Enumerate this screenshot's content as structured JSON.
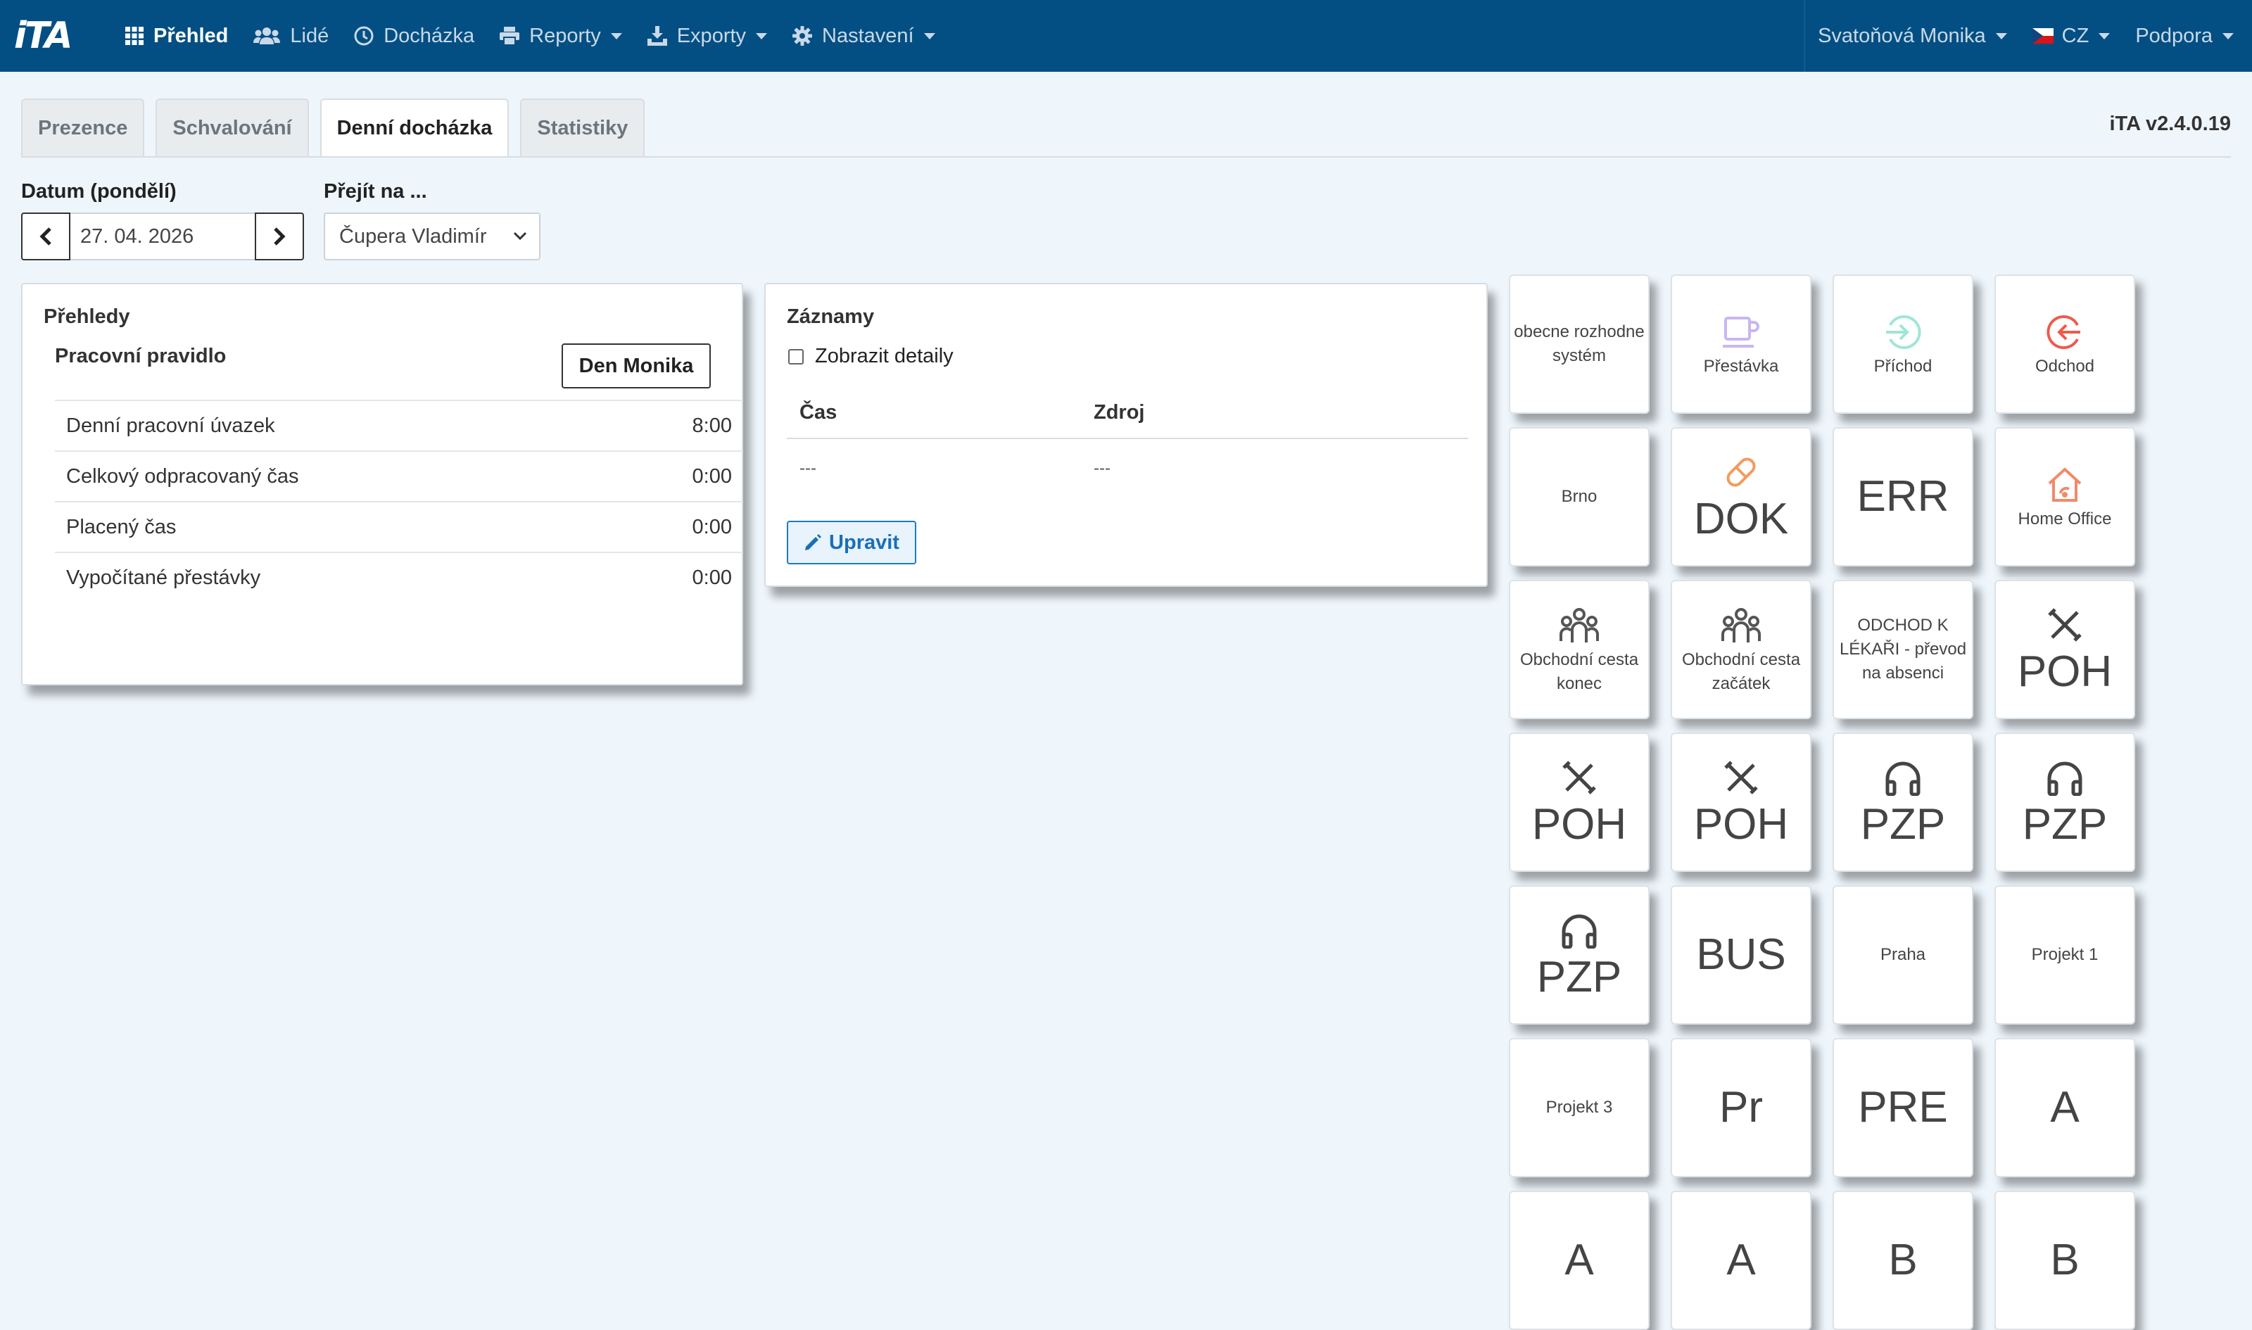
{
  "navbar": {
    "logo": "iTA",
    "items": [
      {
        "label": "Přehled",
        "icon": "grid-icon",
        "active": true
      },
      {
        "label": "Lidé",
        "icon": "users-icon"
      },
      {
        "label": "Docházka",
        "icon": "clock-icon"
      },
      {
        "label": "Reporty",
        "icon": "print-icon"
      },
      {
        "label": "Exporty",
        "icon": "export-icon"
      },
      {
        "label": "Nastavení",
        "icon": "gear-icon"
      }
    ],
    "user": "Svatoňová Monika",
    "language": "CZ",
    "support": "Podpora"
  },
  "tabs": [
    "Prezence",
    "Schvalování",
    "Denní docházka",
    "Statistiky"
  ],
  "active_tab": "Denní docházka",
  "version": "iTA v2.4.0.19",
  "date": {
    "label": "Datum (pondělí)",
    "value": "27. 04. 2026"
  },
  "goto": {
    "label": "Přejít na ...",
    "value": "Čupera Vladimír"
  },
  "overview": {
    "title": "Přehledy",
    "rule_label": "Pracovní pravidlo",
    "rule_button": "Den Monika",
    "rows": [
      {
        "label": "Denní pracovní úvazek",
        "value": "8:00"
      },
      {
        "label": "Celkový odpracovaný čas",
        "value": "0:00"
      },
      {
        "label": "Placený čas",
        "value": "0:00"
      },
      {
        "label": "Vypočítané přestávky",
        "value": "0:00"
      }
    ]
  },
  "records": {
    "title": "Záznamy",
    "show_details": "Zobrazit detaily",
    "columns": [
      "Čas",
      "Zdroj"
    ],
    "rows": [
      [
        "---",
        "---"
      ]
    ],
    "edit_button": "Upravit"
  },
  "terminal": [
    {
      "text": "obecne rozhodne systém",
      "style": "small"
    },
    {
      "text": "Přestávka",
      "style": "small",
      "icon": "coffee-icon",
      "color": "#c9b6f0"
    },
    {
      "text": "Příchod",
      "style": "small",
      "icon": "sign-in-icon",
      "color": "#9ee6d6"
    },
    {
      "text": "Odchod",
      "style": "small",
      "icon": "sign-out-icon",
      "color": "#ee5a4b"
    },
    {
      "text": "Brno",
      "style": "small"
    },
    {
      "text": "DOK",
      "style": "big",
      "icon": "pill-icon",
      "color": "#f39b5e"
    },
    {
      "text": "ERR",
      "style": "big"
    },
    {
      "text": "Home Office",
      "style": "small",
      "icon": "home-icon",
      "color": "#f08a6a"
    },
    {
      "text": "Obchodní cesta konec",
      "style": "small",
      "icon": "people-icon",
      "color": "#555555"
    },
    {
      "text": "Obchodní cesta začátek",
      "style": "small",
      "icon": "people-icon",
      "color": "#555555"
    },
    {
      "text": "ODCHOD K LÉKAŘI - převod na absenci",
      "style": "small"
    },
    {
      "text": "POH",
      "style": "big",
      "icon": "tools-icon",
      "color": "#444444"
    },
    {
      "text": "POH",
      "style": "big",
      "icon": "tools-icon",
      "color": "#444444"
    },
    {
      "text": "POH",
      "style": "big",
      "icon": "tools-icon",
      "color": "#444444"
    },
    {
      "text": "PZP",
      "style": "big",
      "icon": "headphones-icon",
      "color": "#444444"
    },
    {
      "text": "PZP",
      "style": "big",
      "icon": "headphones-icon",
      "color": "#444444"
    },
    {
      "text": "PZP",
      "style": "big",
      "icon": "headphones-icon",
      "color": "#444444"
    },
    {
      "text": "BUS",
      "style": "big"
    },
    {
      "text": "Praha",
      "style": "small"
    },
    {
      "text": "Projekt 1",
      "style": "small"
    },
    {
      "text": "Projekt 3",
      "style": "small"
    },
    {
      "text": "Pr",
      "style": "big"
    },
    {
      "text": "PRE",
      "style": "big"
    },
    {
      "text": "A",
      "style": "big"
    },
    {
      "text": "A",
      "style": "big"
    },
    {
      "text": "A",
      "style": "big"
    },
    {
      "text": "B",
      "style": "big"
    },
    {
      "text": "B",
      "style": "big"
    }
  ]
}
